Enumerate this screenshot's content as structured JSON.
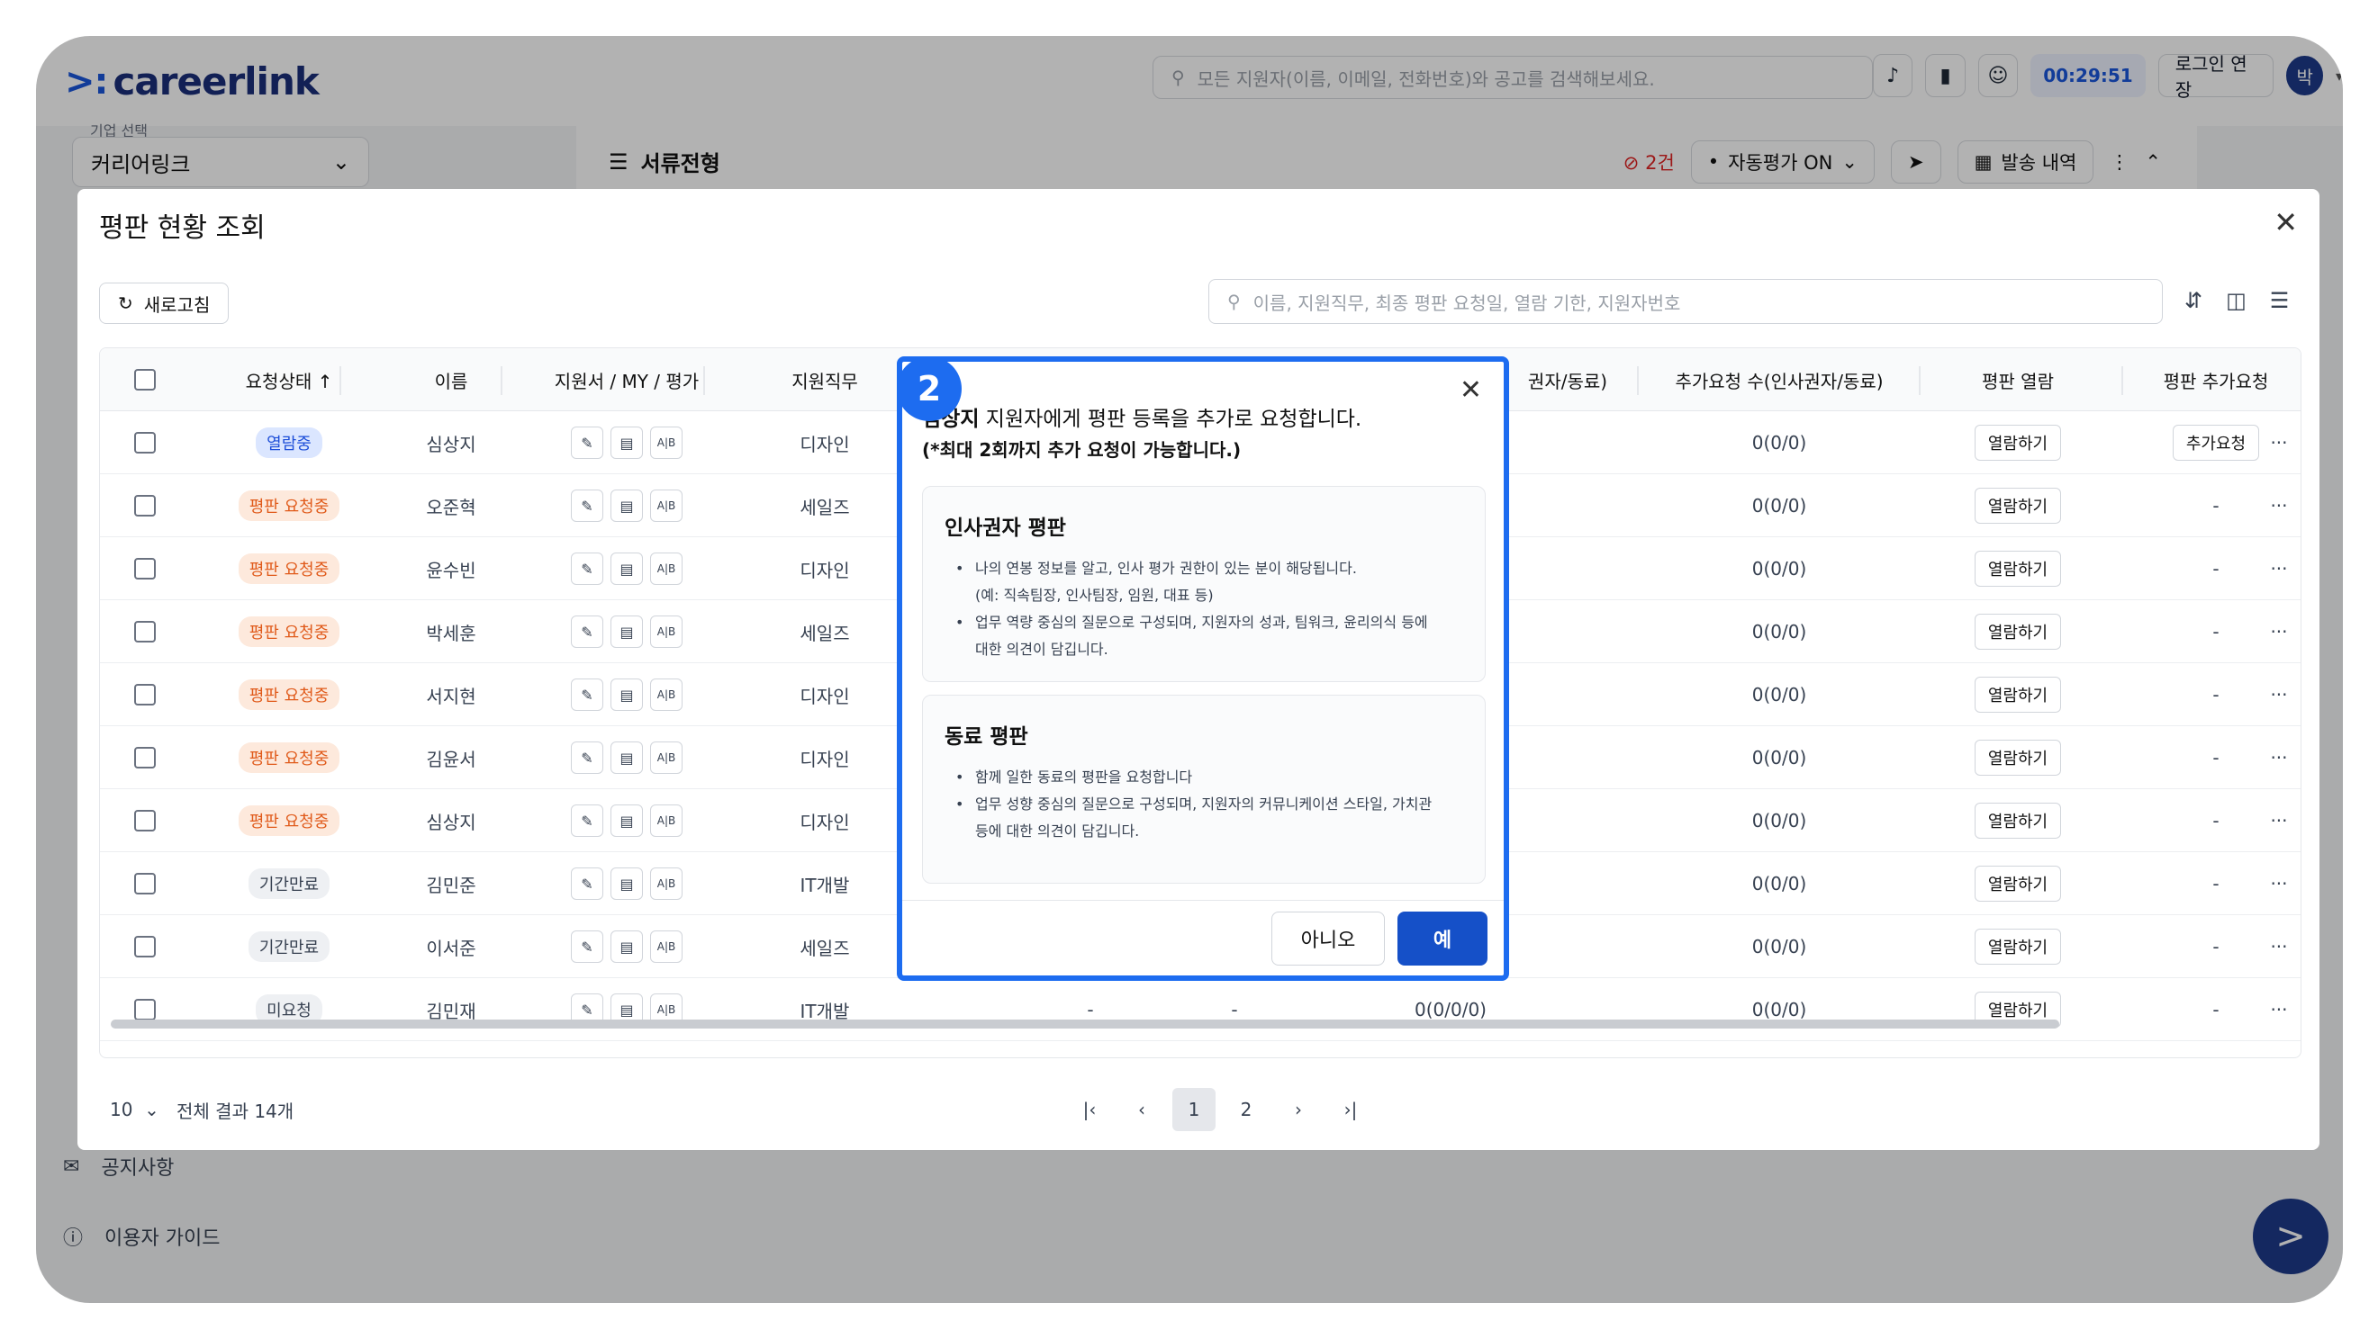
{
  "app": {
    "logo": "careerlink",
    "search_placeholder": "모든 지원자(이름, 이메일, 전화번호)와 공고를 검색해보세요.",
    "timer": "00:29:51",
    "login_extend": "로그인 연장",
    "avatar": "박"
  },
  "company": {
    "label": "기업 선택",
    "value": "커리어링크"
  },
  "stage": {
    "title": "서류전형",
    "hidden_count": "2건",
    "auto_eval": "자동평가 ON",
    "send_history": "발송 내역"
  },
  "sidebar": {
    "notice": "공지사항",
    "guide": "이용자 가이드"
  },
  "panel": {
    "title": "평판 현황 조회",
    "refresh": "새로고침",
    "search_placeholder": "이름, 지원직무, 최종 평판 요청일, 열람 기한, 지원자번호",
    "columns": [
      "요청상태 ↑",
      "이름",
      "지원서 / MY / 평가",
      "지원직무",
      "권자/동료)",
      "추가요청 수(인사권자/동료)",
      "평판 열람",
      "평판 추가요청"
    ],
    "rows": [
      {
        "status": "열람중",
        "kind": "blue",
        "name": "심상지",
        "job": "디자인",
        "c5": "",
        "extra": "0(0/0)",
        "view": "열람하기",
        "add": "추가요청"
      },
      {
        "status": "평판 요청중",
        "kind": "orange",
        "name": "오준혁",
        "job": "세일즈",
        "c5": "",
        "extra": "0(0/0)",
        "view": "열람하기",
        "add": "-"
      },
      {
        "status": "평판 요청중",
        "kind": "orange",
        "name": "윤수빈",
        "job": "디자인",
        "c5": "",
        "extra": "0(0/0)",
        "view": "열람하기",
        "add": "-"
      },
      {
        "status": "평판 요청중",
        "kind": "orange",
        "name": "박세훈",
        "job": "세일즈",
        "c5": "",
        "extra": "0(0/0)",
        "view": "열람하기",
        "add": "-"
      },
      {
        "status": "평판 요청중",
        "kind": "orange",
        "name": "서지현",
        "job": "디자인",
        "c5": "",
        "extra": "0(0/0)",
        "view": "열람하기",
        "add": "-"
      },
      {
        "status": "평판 요청중",
        "kind": "orange",
        "name": "김윤서",
        "job": "디자인",
        "c5": "",
        "extra": "0(0/0)",
        "view": "열람하기",
        "add": "-"
      },
      {
        "status": "평판 요청중",
        "kind": "orange",
        "name": "심상지",
        "job": "디자인",
        "c5": "",
        "extra": "0(0/0)",
        "view": "열람하기",
        "add": "-"
      },
      {
        "status": "기간만료",
        "kind": "gray",
        "name": "김민준",
        "job": "IT개발",
        "c5": "",
        "extra": "0(0/0)",
        "view": "열람하기",
        "add": "-"
      },
      {
        "status": "기간만료",
        "kind": "gray",
        "name": "이서준",
        "job": "세일즈",
        "c5": "",
        "extra": "0(0/0)",
        "view": "열람하기",
        "add": "-"
      },
      {
        "status": "미요청",
        "kind": "gray",
        "name": "김민재",
        "job": "IT개발",
        "c5": "0(0/0/0)",
        "extra": "0(0/0)",
        "view": "열람하기",
        "add": "-",
        "d1": "-",
        "d2": "-"
      }
    ],
    "page_size": "10",
    "total": "전체 결과 14개",
    "pages": [
      "1",
      "2"
    ]
  },
  "dialog": {
    "step": "2",
    "msg_name": "심상지",
    "msg_rest": " 지원자에게 평판 등록을 추가로 요청합니다.",
    "note": "(*최대 2회까지 추가 요청이 가능합니다.)",
    "box1_title": "인사권자 평판",
    "box1_lines": [
      "나의 연봉 정보를 알고, 인사 평가 권한이 있는 분이 해당됩니다.",
      "(예: 직속팀장, 인사팀장, 임원, 대표 등)",
      "업무 역량 중심의 질문으로 구성되며, 지원자의 성과, 팀워크, 윤리의식 등에",
      "대한 의견이 담깁니다."
    ],
    "box2_title": "동료 평판",
    "box2_lines": [
      "함께 일한 동료의 평판을 요청합니다",
      "업무 성향 중심의 질문으로 구성되며, 지원자의 커뮤니케이션 스타일, 가치관",
      "등에 대한 의견이 담깁니다."
    ],
    "no": "아니오",
    "yes": "예"
  },
  "colors": {
    "accent": "#1d6cf0",
    "primary": "#1550c8",
    "badge_blue_bg": "#dbe6ff",
    "badge_blue_fg": "#1d4ed8",
    "badge_orange_bg": "#fde9dc",
    "badge_orange_fg": "#e05a1a"
  }
}
